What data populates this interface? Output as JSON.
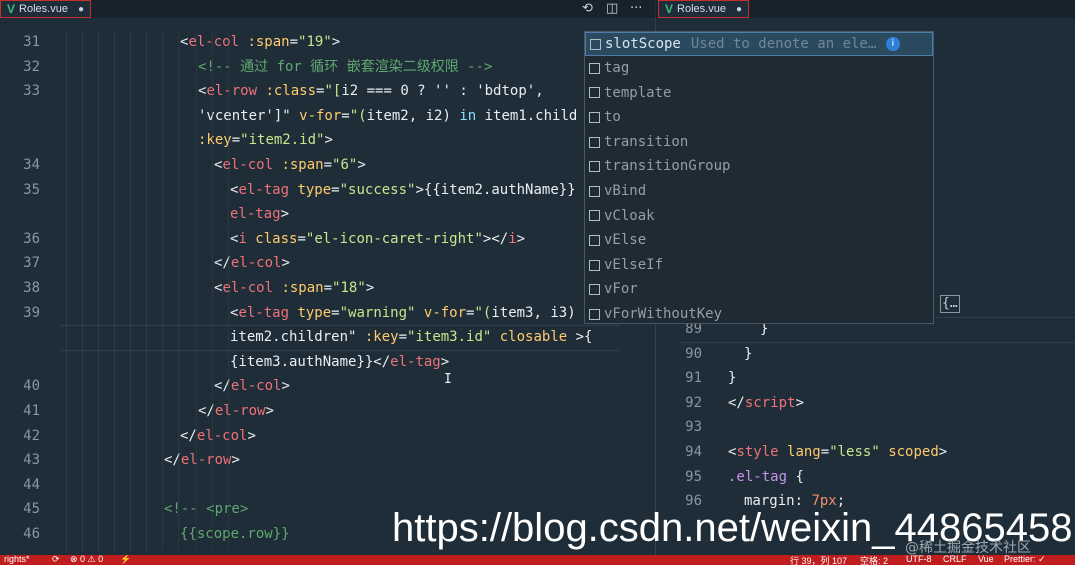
{
  "left_tab": {
    "icon": "V",
    "label": "Roles.vue",
    "dot": "●"
  },
  "right_tab": {
    "icon": "V",
    "label": "Roles.vue",
    "dot": "●"
  },
  "actions": {
    "compare": "⟲",
    "split": "◫",
    "more": "···"
  },
  "left_editor": {
    "lines": [
      {
        "n": "31",
        "segs": [
          [
            "t-punc",
            "<"
          ],
          [
            "t-tag",
            "el-col"
          ],
          [
            "t-attr",
            " :span"
          ],
          [
            "t-punc",
            "="
          ],
          [
            "t-str",
            "\"19\""
          ],
          [
            "t-punc",
            ">"
          ]
        ]
      },
      {
        "n": "32",
        "segs": [
          [
            "t-cmt",
            "<!-- 通过 for 循环 嵌套渲染二级权限 -->"
          ]
        ]
      },
      {
        "n": "33",
        "segs": [
          [
            "t-punc",
            "<"
          ],
          [
            "t-tag",
            "el-row"
          ],
          [
            "t-attr",
            " :class"
          ],
          [
            "t-punc",
            "="
          ],
          [
            "t-str",
            "\"["
          ],
          [
            "t-var",
            "i2 === 0 ? '' : 'bdtop',"
          ]
        ]
      },
      {
        "n": "",
        "segs": [
          [
            "t-var",
            "'vcenter']\""
          ],
          [
            "t-attr",
            " v-for"
          ],
          [
            "t-punc",
            "="
          ],
          [
            "t-str",
            "\"("
          ],
          [
            "t-var",
            "item2, i2) "
          ],
          [
            "t-kw",
            "in"
          ],
          [
            "t-var",
            " item1.child"
          ]
        ]
      },
      {
        "n": "",
        "segs": [
          [
            "t-attr",
            ":key"
          ],
          [
            "t-punc",
            "="
          ],
          [
            "t-str",
            "\"item2.id\""
          ],
          [
            "t-punc",
            ">"
          ]
        ]
      },
      {
        "n": "34",
        "segs": [
          [
            "t-punc",
            "<"
          ],
          [
            "t-tag",
            "el-col"
          ],
          [
            "t-attr",
            " :span"
          ],
          [
            "t-punc",
            "="
          ],
          [
            "t-str",
            "\"6\""
          ],
          [
            "t-punc",
            ">"
          ]
        ]
      },
      {
        "n": "35",
        "segs": [
          [
            "t-punc",
            "<"
          ],
          [
            "t-tag",
            "el-tag"
          ],
          [
            "t-attr",
            " type"
          ],
          [
            "t-punc",
            "="
          ],
          [
            "t-str",
            "\"success\""
          ],
          [
            "t-punc",
            ">"
          ],
          [
            "t-var",
            "{{item2.authName}}"
          ]
        ]
      },
      {
        "n": "",
        "segs": [
          [
            "t-tag",
            "el-tag"
          ],
          [
            "t-punc",
            ">"
          ]
        ]
      },
      {
        "n": "36",
        "segs": [
          [
            "t-punc",
            "<"
          ],
          [
            "t-tag",
            "i"
          ],
          [
            "t-attr",
            " class"
          ],
          [
            "t-punc",
            "="
          ],
          [
            "t-str",
            "\"el-icon-caret-right\""
          ],
          [
            "t-punc",
            "></"
          ],
          [
            "t-tag",
            "i"
          ],
          [
            "t-punc",
            ">"
          ]
        ]
      },
      {
        "n": "37",
        "segs": [
          [
            "t-punc",
            "</"
          ],
          [
            "t-tag",
            "el-col"
          ],
          [
            "t-punc",
            ">"
          ]
        ]
      },
      {
        "n": "38",
        "segs": [
          [
            "t-punc",
            "<"
          ],
          [
            "t-tag",
            "el-col"
          ],
          [
            "t-attr",
            " :span"
          ],
          [
            "t-punc",
            "="
          ],
          [
            "t-str",
            "\"18\""
          ],
          [
            "t-punc",
            ">"
          ]
        ]
      },
      {
        "n": "39",
        "segs": [
          [
            "t-punc",
            "<"
          ],
          [
            "t-tag",
            "el-tag"
          ],
          [
            "t-attr",
            " type"
          ],
          [
            "t-punc",
            "="
          ],
          [
            "t-str",
            "\"warning\""
          ],
          [
            "t-attr",
            " v-for"
          ],
          [
            "t-punc",
            "="
          ],
          [
            "t-str",
            "\"("
          ],
          [
            "t-var",
            "item3, i3)"
          ]
        ]
      },
      {
        "n": "",
        "segs": [
          [
            "t-var",
            "item2.children\""
          ],
          [
            "t-attr",
            " :key"
          ],
          [
            "t-punc",
            "="
          ],
          [
            "t-str",
            "\"item3.id\""
          ],
          [
            "t-attr",
            " closable "
          ],
          [
            "t-punc",
            ">{"
          ]
        ]
      },
      {
        "n": "",
        "segs": [
          [
            "t-var",
            "{item3.authName}}"
          ],
          [
            "t-punc",
            "</"
          ],
          [
            "t-tag",
            "el-tag"
          ],
          [
            "t-punc",
            ">"
          ]
        ]
      },
      {
        "n": "40",
        "segs": [
          [
            "t-punc",
            "</"
          ],
          [
            "t-tag",
            "el-col"
          ],
          [
            "t-punc",
            ">"
          ]
        ]
      },
      {
        "n": "41",
        "segs": [
          [
            "t-punc",
            "</"
          ],
          [
            "t-tag",
            "el-row"
          ],
          [
            "t-punc",
            ">"
          ]
        ]
      },
      {
        "n": "42",
        "segs": [
          [
            "t-punc",
            "</"
          ],
          [
            "t-tag",
            "el-col"
          ],
          [
            "t-punc",
            ">"
          ]
        ]
      },
      {
        "n": "43",
        "segs": [
          [
            "t-punc",
            "</"
          ],
          [
            "t-tag",
            "el-row"
          ],
          [
            "t-punc",
            ">"
          ]
        ]
      },
      {
        "n": "44",
        "segs": []
      },
      {
        "n": "45",
        "segs": [
          [
            "t-cmt",
            "<!-- <pre>"
          ]
        ]
      },
      {
        "n": "46",
        "segs": [
          [
            "t-cmt",
            "{{scope.row}}"
          ]
        ]
      }
    ]
  },
  "right_editor": {
    "lines": [
      {
        "n": "89",
        "segs": [
          [
            "t-punc",
            "}"
          ]
        ]
      },
      {
        "n": "90",
        "segs": [
          [
            "t-punc",
            "}"
          ]
        ]
      },
      {
        "n": "91",
        "segs": [
          [
            "t-punc",
            "}"
          ]
        ]
      },
      {
        "n": "92",
        "segs": [
          [
            "t-punc",
            "</"
          ],
          [
            "t-tag",
            "script"
          ],
          [
            "t-punc",
            ">"
          ]
        ]
      },
      {
        "n": "93",
        "segs": []
      },
      {
        "n": "94",
        "segs": [
          [
            "t-punc",
            "<"
          ],
          [
            "t-tag",
            "style"
          ],
          [
            "t-attr",
            " lang"
          ],
          [
            "t-punc",
            "="
          ],
          [
            "t-str",
            "\"less\""
          ],
          [
            "t-attr",
            " scoped"
          ],
          [
            "t-punc",
            ">"
          ]
        ]
      },
      {
        "n": "95",
        "segs": [
          [
            "t-css",
            ".el-tag"
          ],
          [
            "t-punc",
            " {"
          ]
        ]
      },
      {
        "n": "96",
        "segs": [
          [
            "t-var",
            "margin"
          ],
          [
            "t-punc",
            ": "
          ],
          [
            "t-num",
            "7px"
          ],
          [
            "t-punc",
            ";"
          ]
        ]
      }
    ],
    "folded": "{…"
  },
  "suggestions": {
    "items": [
      {
        "label": "slotScope",
        "desc": "Used to denote an eleme…",
        "selected": true
      },
      {
        "label": "tag"
      },
      {
        "label": "template"
      },
      {
        "label": "to"
      },
      {
        "label": "transition"
      },
      {
        "label": "transitionGroup"
      },
      {
        "label": "vBind"
      },
      {
        "label": "vCloak"
      },
      {
        "label": "vElse"
      },
      {
        "label": "vElseIf"
      },
      {
        "label": "vFor"
      },
      {
        "label": "vForWithoutKey"
      }
    ],
    "info_icon": "i"
  },
  "statusbar": {
    "branch": "rights*",
    "sync": "⟳",
    "problems": "⊗ 0 ⚠ 0",
    "bolt": "⚡",
    "position": "行 39，列 107",
    "spaces": "空格: 2",
    "encoding": "UTF-8",
    "eol": "CRLF",
    "language": "Vue",
    "formatter": "Prettier: ✓"
  },
  "watermark": {
    "url": "https://blog.csdn.net/weixin_44865458",
    "site": "@稀土掘金技术社区"
  }
}
